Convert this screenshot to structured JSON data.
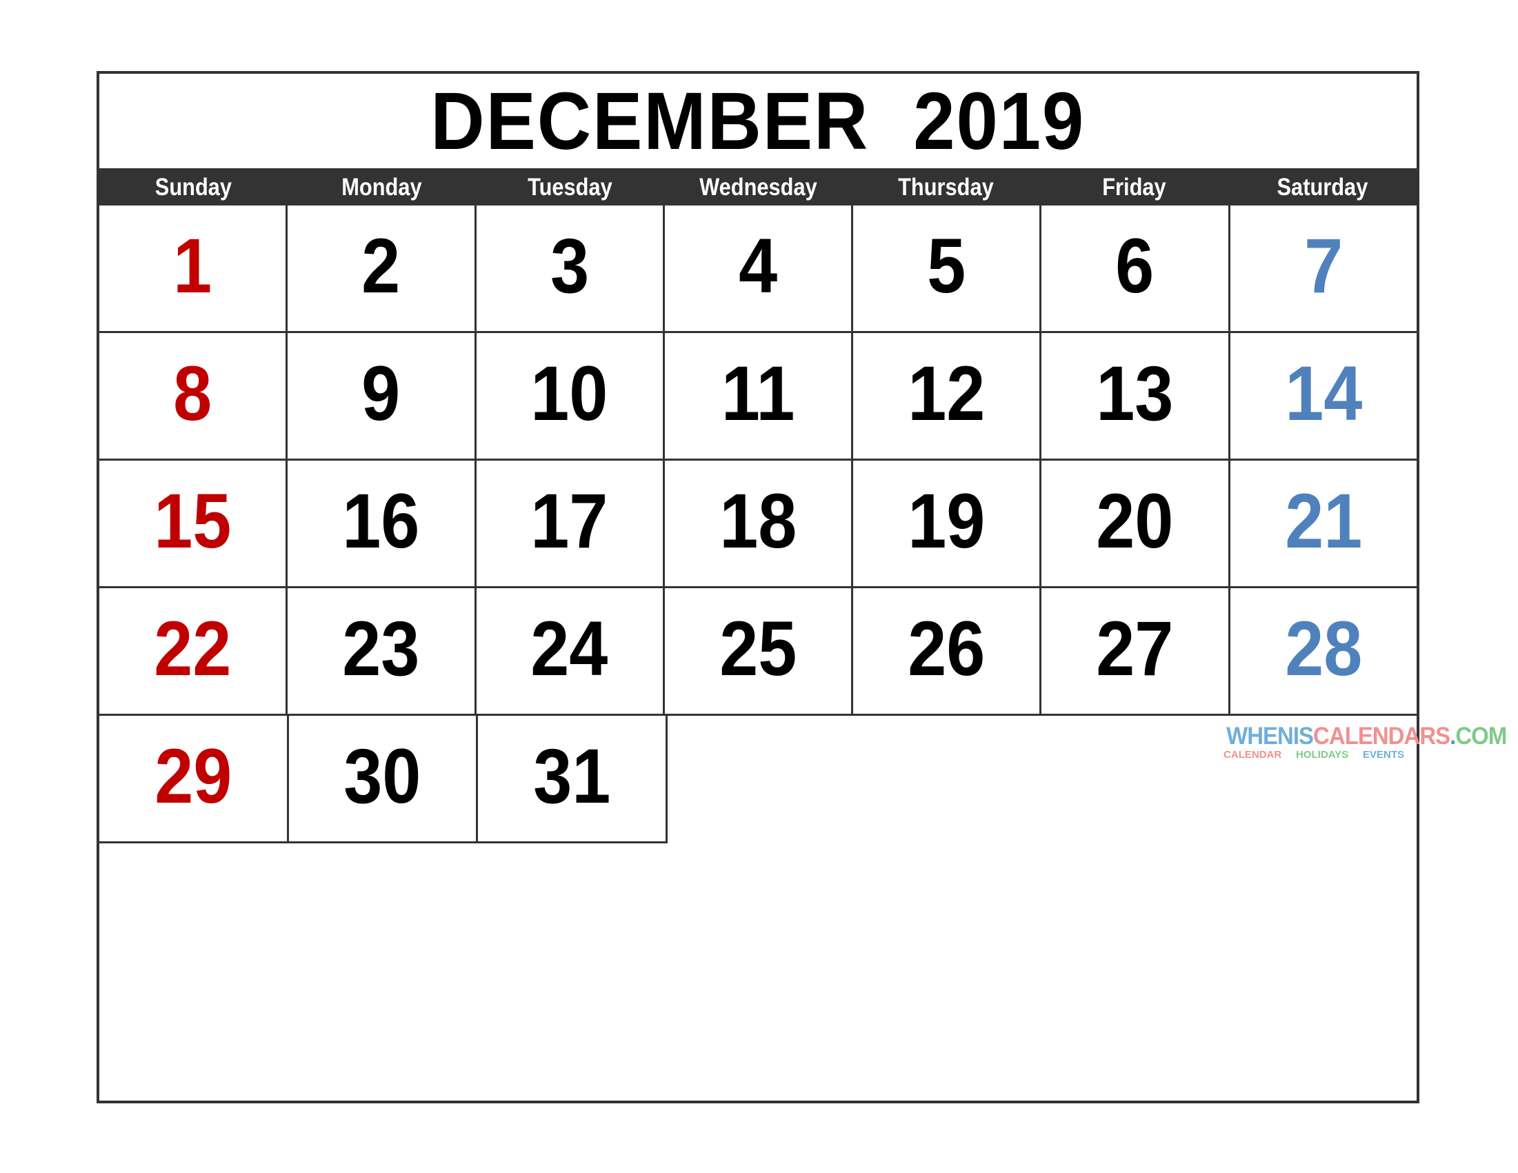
{
  "calendar": {
    "title": "DECEMBER  2019",
    "month": "December",
    "year": "2019",
    "weekday_headers": [
      "Sunday",
      "Monday",
      "Tuesday",
      "Wednesday",
      "Thursday",
      "Friday",
      "Saturday"
    ],
    "colors": {
      "sunday": "#C00000",
      "saturday": "#4F81BD",
      "weekday": "#000000",
      "header_bar_bg": "#333333",
      "header_bar_text": "#FFFFFF",
      "grid_line": "#333333",
      "page_bg": "#FFFFFF"
    },
    "weeks": [
      {
        "index": 1,
        "days": [
          {
            "num": "1",
            "kind": "sun"
          },
          {
            "num": "2",
            "kind": "weekday"
          },
          {
            "num": "3",
            "kind": "weekday"
          },
          {
            "num": "4",
            "kind": "weekday"
          },
          {
            "num": "5",
            "kind": "weekday"
          },
          {
            "num": "6",
            "kind": "weekday"
          },
          {
            "num": "7",
            "kind": "sat"
          }
        ]
      },
      {
        "index": 2,
        "days": [
          {
            "num": "8",
            "kind": "sun"
          },
          {
            "num": "9",
            "kind": "weekday"
          },
          {
            "num": "10",
            "kind": "weekday"
          },
          {
            "num": "11",
            "kind": "weekday"
          },
          {
            "num": "12",
            "kind": "weekday"
          },
          {
            "num": "13",
            "kind": "weekday"
          },
          {
            "num": "14",
            "kind": "sat"
          }
        ]
      },
      {
        "index": 3,
        "days": [
          {
            "num": "15",
            "kind": "sun"
          },
          {
            "num": "16",
            "kind": "weekday"
          },
          {
            "num": "17",
            "kind": "weekday"
          },
          {
            "num": "18",
            "kind": "weekday"
          },
          {
            "num": "19",
            "kind": "weekday"
          },
          {
            "num": "20",
            "kind": "weekday"
          },
          {
            "num": "21",
            "kind": "sat"
          }
        ]
      },
      {
        "index": 4,
        "days": [
          {
            "num": "22",
            "kind": "sun"
          },
          {
            "num": "23",
            "kind": "weekday"
          },
          {
            "num": "24",
            "kind": "weekday"
          },
          {
            "num": "25",
            "kind": "weekday"
          },
          {
            "num": "26",
            "kind": "weekday"
          },
          {
            "num": "27",
            "kind": "weekday"
          },
          {
            "num": "28",
            "kind": "sat"
          }
        ]
      },
      {
        "index": 5,
        "days": [
          {
            "num": "29",
            "kind": "sun"
          },
          {
            "num": "30",
            "kind": "weekday"
          },
          {
            "num": "31",
            "kind": "weekday"
          },
          {
            "num": "",
            "kind": "empty"
          },
          {
            "num": "",
            "kind": "empty"
          },
          {
            "num": "",
            "kind": "empty"
          },
          {
            "num": "",
            "kind": "empty"
          }
        ]
      },
      {
        "index": 6,
        "days": [
          {
            "num": "",
            "kind": "empty"
          },
          {
            "num": "",
            "kind": "empty"
          },
          {
            "num": "",
            "kind": "empty"
          },
          {
            "num": "",
            "kind": "empty"
          },
          {
            "num": "",
            "kind": "empty"
          },
          {
            "num": "",
            "kind": "empty"
          },
          {
            "num": "",
            "kind": "empty"
          }
        ]
      }
    ]
  },
  "watermark": {
    "part1": "WHENIS",
    "part2": "CALENDARS",
    "dot": ".",
    "part3": "COM",
    "sub1": "CALENDAR",
    "sub2": "HOLIDAYS",
    "sub3": "EVENTS",
    "colors": {
      "part1": "#6FAEDB",
      "part2": "#F2908E",
      "dot": "#5B8FD6",
      "part3": "#7FC98A"
    }
  }
}
